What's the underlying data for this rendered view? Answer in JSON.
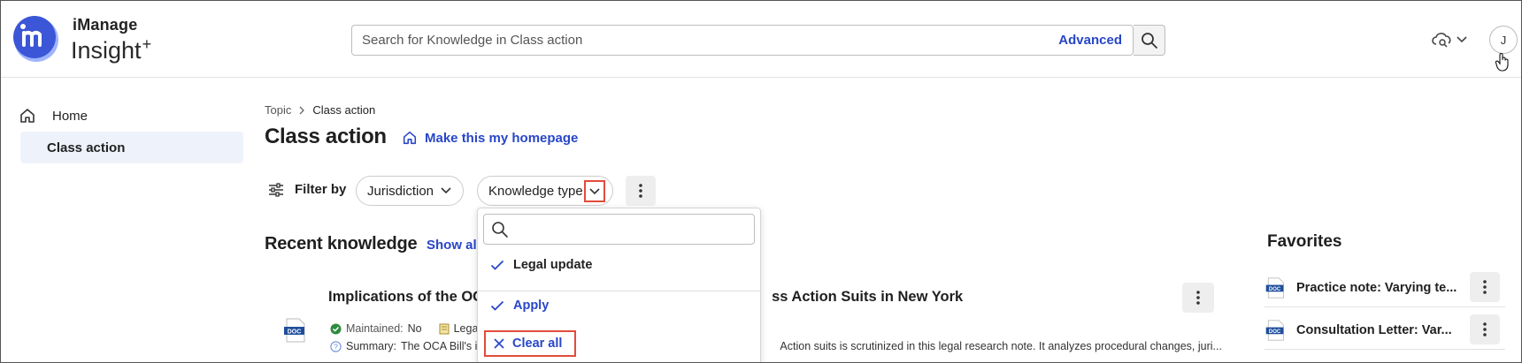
{
  "brand": {
    "line1": "iManage",
    "line2": "Insight",
    "plus": "+"
  },
  "header": {
    "search_placeholder": "Search for Knowledge in Class action",
    "advanced_label": "Advanced",
    "avatar_initial": "J"
  },
  "sidebar": {
    "items": [
      {
        "label": "Home",
        "icon": "home-icon"
      },
      {
        "label": "Class action",
        "active": true
      }
    ]
  },
  "breadcrumb": {
    "root": "Topic",
    "current": "Class action"
  },
  "page": {
    "title": "Class action",
    "make_home_label": "Make this my homepage"
  },
  "filters": {
    "label": "Filter by",
    "jurisdiction": "Jurisdiction",
    "knowledge_type": "Knowledge type"
  },
  "dropdown": {
    "search_placeholder": "",
    "options": [
      {
        "label": "Legal update",
        "checked": true
      }
    ],
    "apply_label": "Apply",
    "clear_label": "Clear all"
  },
  "recent": {
    "title": "Recent knowledge",
    "show_all": "Show all",
    "item": {
      "title_start": "Implications of the OC",
      "title_end": "ss Action Suits in New York",
      "maintained_label": "Maintained:",
      "maintained_value": "No",
      "type_fragment": "Lega",
      "summary_label": "Summary:",
      "summary_start": "The OCA Bill's i",
      "summary_end": "Action suits is scrutinized in this legal research note. It analyzes procedural changes, juri..."
    }
  },
  "favorites": {
    "title": "Favorites",
    "items": [
      {
        "label": "Practice note: Varying te..."
      },
      {
        "label": "Consultation Letter: Var..."
      }
    ]
  },
  "colors": {
    "accent": "#2846c8",
    "highlight": "#e24b3b",
    "logo": "#3b56d6"
  }
}
